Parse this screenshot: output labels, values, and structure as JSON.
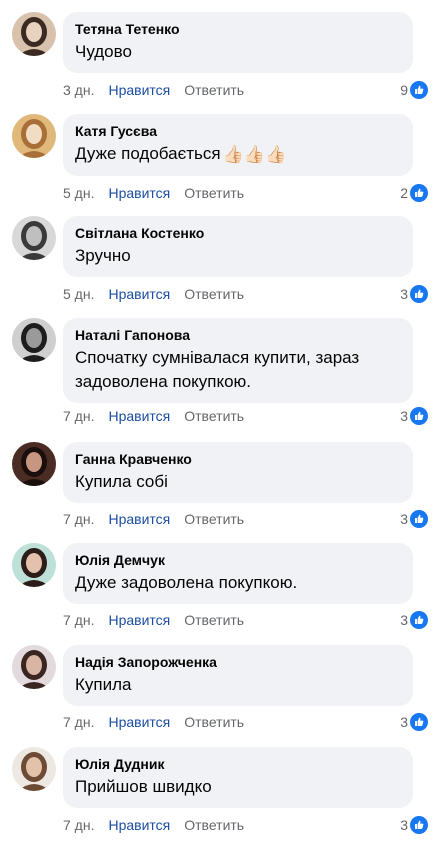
{
  "actions": {
    "like": "Нравится",
    "reply": "Ответить"
  },
  "colors": {
    "bubble": "#f0f2f5",
    "like_link": "#1b4ea3",
    "meta_text": "#65676b",
    "like_badge": "#1877f2"
  },
  "comments": [
    {
      "author": "Тетяна Тетенко",
      "text": "Чудово",
      "time": "3 дн.",
      "likes": "9",
      "avatar": "avatar-photo"
    },
    {
      "author": "Катя Гусєва",
      "text": "Дуже подобається",
      "emoji": "👍🏻👍🏻👍🏻",
      "time": "5 дн.",
      "likes": "2",
      "avatar": "avatar-photo"
    },
    {
      "author": "Світлана Костенко",
      "text": "Зручно",
      "time": "5 дн.",
      "likes": "3",
      "avatar": "avatar-photo"
    },
    {
      "author": "Наталі Гапонова",
      "text": "Спочатку сумнівалася купити, зараз задоволена покупкою.",
      "time": "7 дн.",
      "likes": "3",
      "avatar": "avatar-photo"
    },
    {
      "author": "Ганна Кравченко",
      "text": "Купила собі",
      "time": "7 дн.",
      "likes": "3",
      "avatar": "avatar-photo"
    },
    {
      "author": "Юлія Демчук",
      "text": "Дуже задоволена покупкою.",
      "time": "7 дн.",
      "likes": "3",
      "avatar": "avatar-photo"
    },
    {
      "author": "Надія Запорожченка",
      "text": "Купила",
      "time": "7 дн.",
      "likes": "3",
      "avatar": "avatar-photo"
    },
    {
      "author": "Юлія Дудник",
      "text": "Прийшов швидко",
      "time": "7 дн.",
      "likes": "3",
      "avatar": "avatar-photo"
    }
  ]
}
